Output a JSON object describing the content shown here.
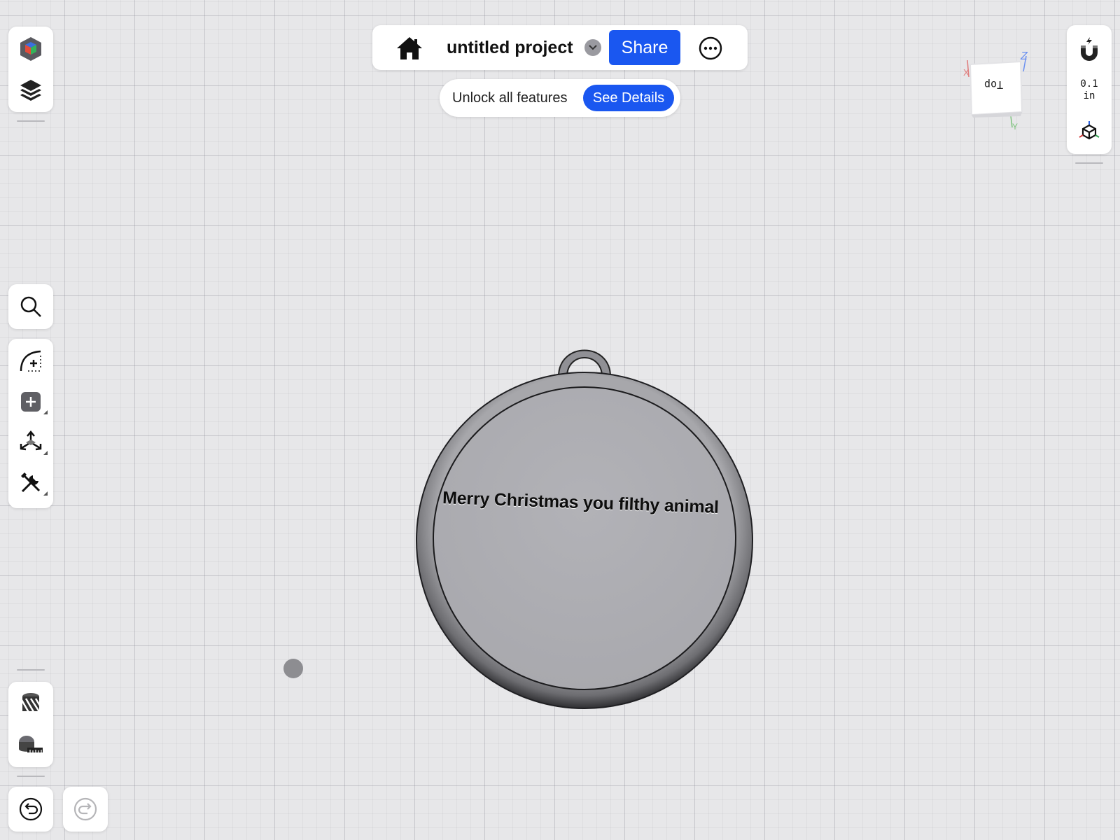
{
  "project": {
    "title": "untitled project",
    "share_label": "Share"
  },
  "banner": {
    "text": "Unlock all features",
    "button_label": "See Details"
  },
  "grid": {
    "value": "0.1",
    "unit": "in"
  },
  "view_cube": {
    "face_label": "Top",
    "axes": [
      "X",
      "Y",
      "Z"
    ]
  },
  "model": {
    "text": "Merry Christmas you filthy animal"
  },
  "icons": {
    "left_top": [
      "workspace-cube-icon",
      "layers-icon"
    ],
    "left_search": [
      "search-icon"
    ],
    "left_tools": [
      "sketch-icon",
      "add-shape-icon",
      "transform-icon",
      "tools-icon"
    ],
    "left_bottom": [
      "section-view-icon",
      "measure-tape-icon"
    ],
    "history": [
      "undo-icon",
      "redo-icon"
    ],
    "right": [
      "snap-magnet-icon",
      "view-options-icon"
    ]
  },
  "colors": {
    "accent": "#1a57f0",
    "panel": "#ffffff",
    "background": "#e7e7e9"
  }
}
